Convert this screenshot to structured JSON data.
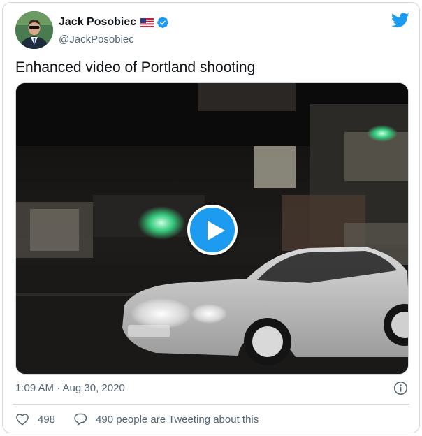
{
  "author": {
    "display_name": "Jack Posobiec",
    "handle": "@JackPosobiec",
    "flag_icon": "us-flag-icon",
    "verified_icon": "verified-badge-icon"
  },
  "tweet": {
    "text": "Enhanced video of Portland shooting",
    "timestamp": "1:09 AM · Aug 30, 2020"
  },
  "media": {
    "type": "video",
    "play_icon": "play-icon"
  },
  "engagement": {
    "likes": "498",
    "conversation": "490 people are Tweeting about this"
  },
  "colors": {
    "accent": "#1d9bf0",
    "text": "#0f1419",
    "secondary_text": "#536471",
    "border": "#cfd9de"
  }
}
